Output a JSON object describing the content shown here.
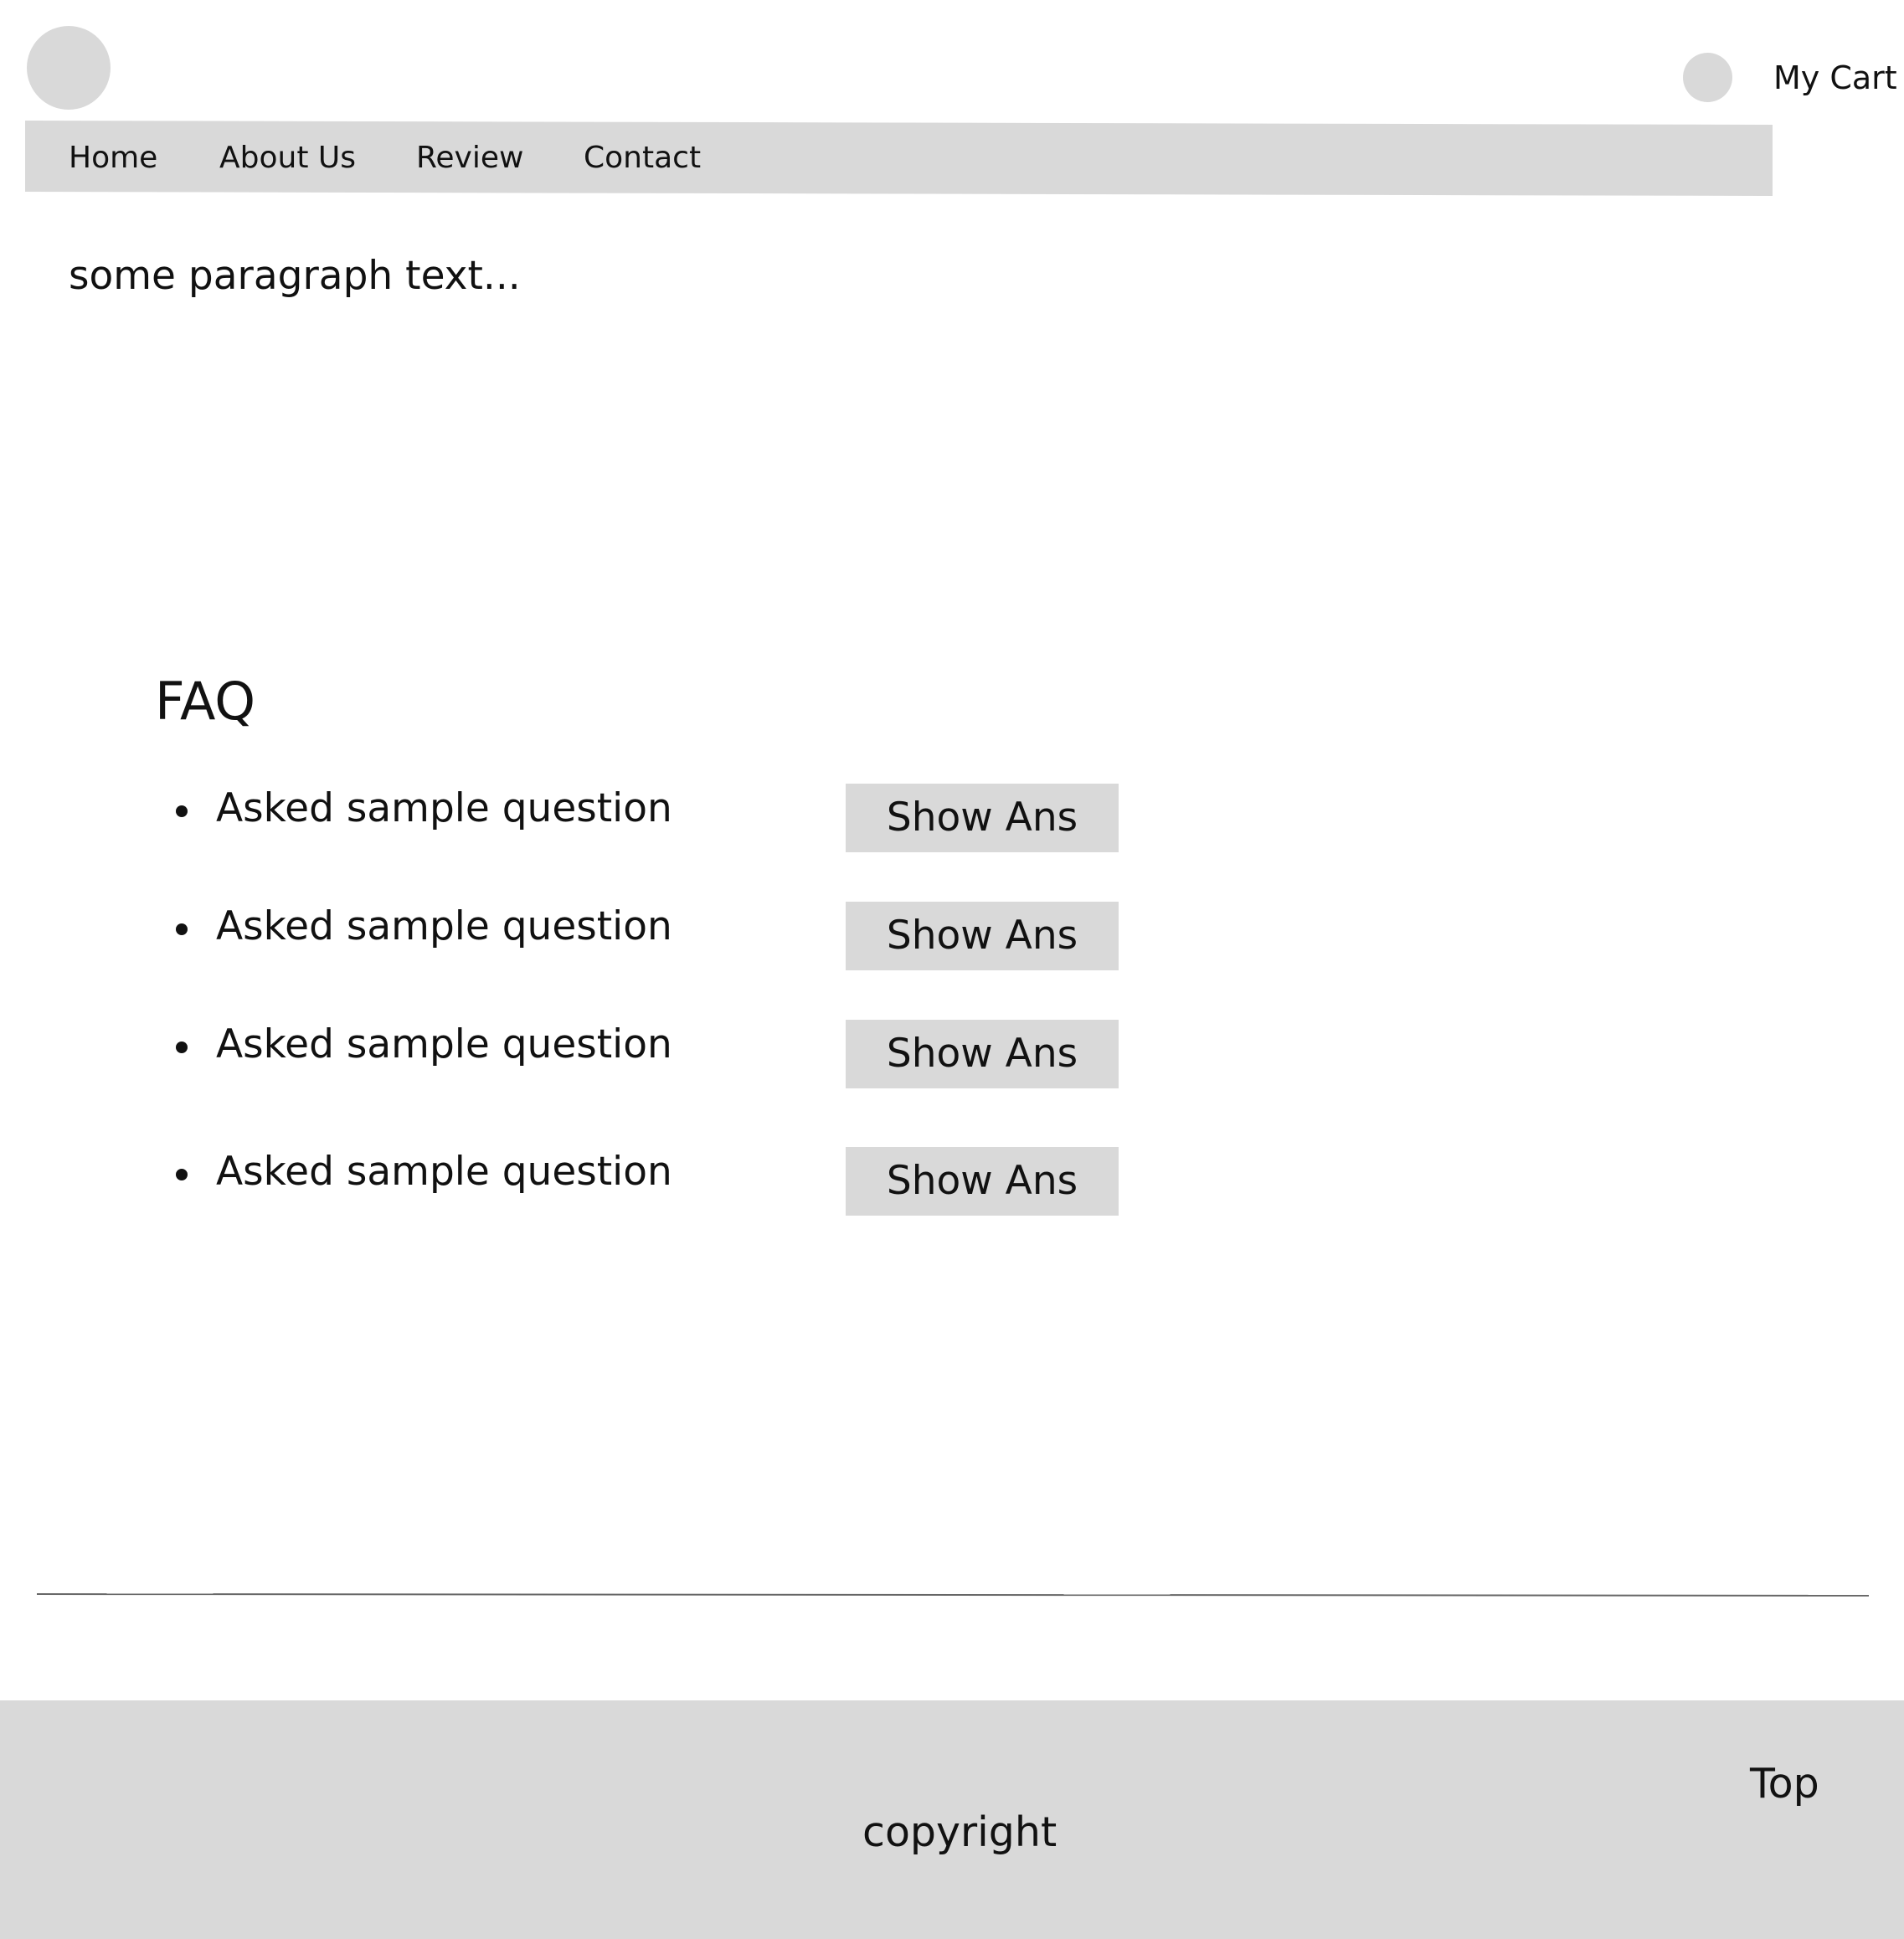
{
  "header": {
    "logo_icon": "logo-placeholder",
    "cart_icon": "cart-placeholder-icon",
    "cart_label": "My Cart"
  },
  "nav": {
    "items": [
      {
        "label": "Home"
      },
      {
        "label": "About Us"
      },
      {
        "label": "Review"
      },
      {
        "label": "Contact"
      }
    ]
  },
  "main": {
    "paragraph": "some paragraph text...",
    "faq": {
      "title": "FAQ",
      "items": [
        {
          "question": "Asked sample question",
          "button_label": "Show Ans"
        },
        {
          "question": "Asked sample question",
          "button_label": "Show Ans"
        },
        {
          "question": "Asked sample question",
          "button_label": "Show Ans"
        },
        {
          "question": "Asked sample question",
          "button_label": "Show Ans"
        }
      ]
    }
  },
  "footer": {
    "copyright": "copyright",
    "top_link": "Top"
  },
  "colors": {
    "placeholder_gray": "#d9d9d9",
    "text": "#111111",
    "background": "#ffffff"
  }
}
